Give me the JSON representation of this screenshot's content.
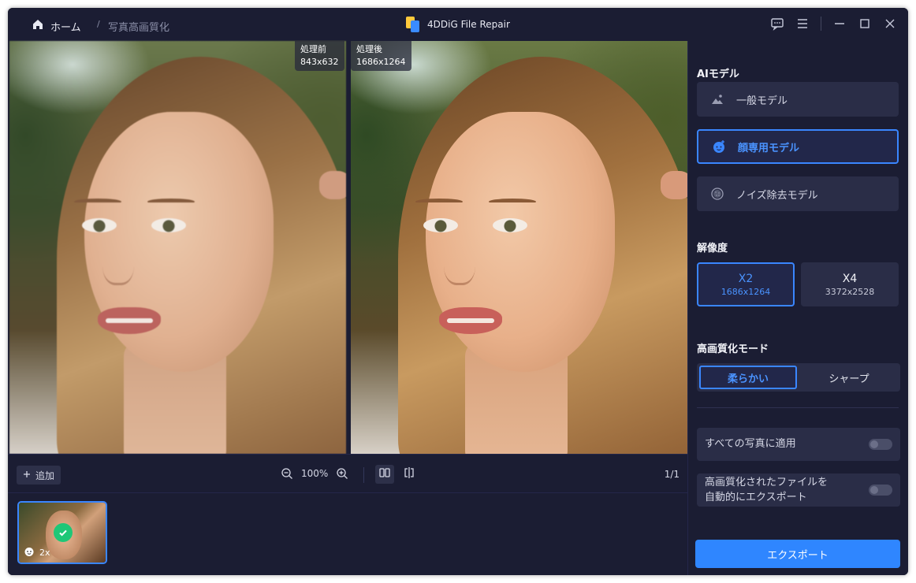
{
  "titlebar": {
    "home_label": "ホーム",
    "separator": "/",
    "current_page": "写真高画質化",
    "app_name": "4DDiG File Repair"
  },
  "preview": {
    "before_label": "処理前",
    "before_size": "843x632",
    "after_label": "処理後",
    "after_size": "1686x1264"
  },
  "toolbar": {
    "add_label": "追加",
    "zoom_level": "100%",
    "page_count": "1/1"
  },
  "thumbnail": {
    "scale_label": "2x"
  },
  "panel": {
    "ai_model_title": "AIモデル",
    "models": [
      {
        "label": "一般モデル",
        "selected": false
      },
      {
        "label": "顔専用モデル",
        "selected": true
      },
      {
        "label": "ノイズ除去モデル",
        "selected": false
      }
    ],
    "resolution_title": "解像度",
    "resolutions": [
      {
        "label": "X2",
        "size": "1686x1264",
        "selected": true
      },
      {
        "label": "X4",
        "size": "3372x2528",
        "selected": false
      }
    ],
    "mode_title": "高画質化モード",
    "modes": [
      {
        "label": "柔らかい",
        "selected": true
      },
      {
        "label": "シャープ",
        "selected": false
      }
    ],
    "apply_all_label": "すべての写真に適用",
    "apply_all_on": false,
    "auto_export_line1": "高画質化されたファイルを",
    "auto_export_line2": "自動的にエクスポート",
    "auto_export_on": false,
    "export_label": "エクスポート"
  },
  "colors": {
    "accent": "#3a86ff",
    "background": "#1b1d33",
    "card": "#2a2d47",
    "export": "#2f86ff",
    "success": "#1ec777"
  }
}
